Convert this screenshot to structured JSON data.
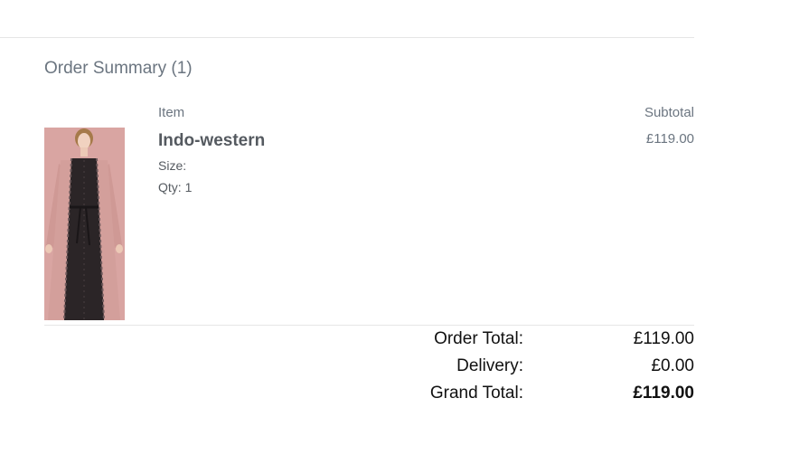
{
  "summary": {
    "title": "Order Summary (1)"
  },
  "table": {
    "headers": {
      "item": "Item",
      "subtotal": "Subtotal"
    },
    "items": [
      {
        "name": "Indo-western",
        "size_label": "Size:",
        "size_value": "",
        "qty_label": "Qty:",
        "qty_value": "1",
        "subtotal": "£119.00",
        "image_icon": "product-photo-dress"
      }
    ]
  },
  "totals": {
    "order_total_label": "Order Total:",
    "order_total_value": "£119.00",
    "delivery_label": "Delivery:",
    "delivery_value": "£0.00",
    "grand_total_label": "Grand Total:",
    "grand_total_value": "£119.00"
  },
  "colors": {
    "muted_text": "#6b7580",
    "body_text": "#555a60",
    "dark_text": "#111111",
    "divider": "#e6e6e6",
    "dress_pink": "#d9a5a2"
  }
}
